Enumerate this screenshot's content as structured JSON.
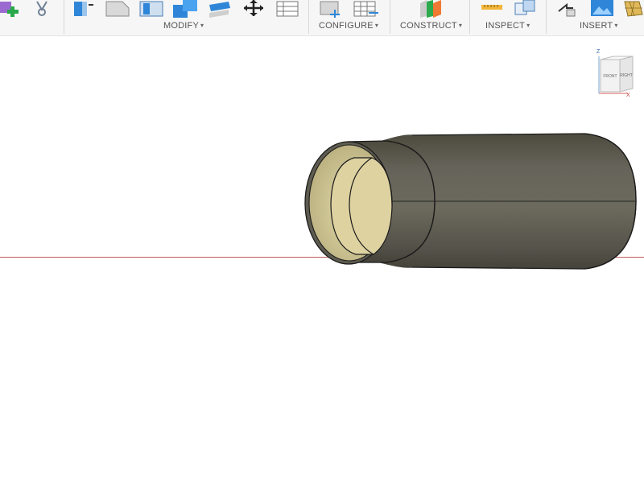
{
  "toolbar": {
    "groups": {
      "modify": {
        "label": "MODIFY"
      },
      "configure": {
        "label": "CONFIGURE"
      },
      "construct": {
        "label": "CONSTRUCT"
      },
      "inspect": {
        "label": "INSPECT"
      },
      "insert": {
        "label": "INSERT"
      }
    }
  },
  "viewcube": {
    "face_front": "FRONT",
    "face_right": "RIGHT",
    "axis_z": "Z",
    "axis_x": "X"
  },
  "colors": {
    "toolbar_bg": "#f6f6f6",
    "body_color": "#5d5b4c",
    "inner_color": "#d9cf9c",
    "axis_red": "#c25a5a",
    "icon_blue": "#2f86d8"
  }
}
